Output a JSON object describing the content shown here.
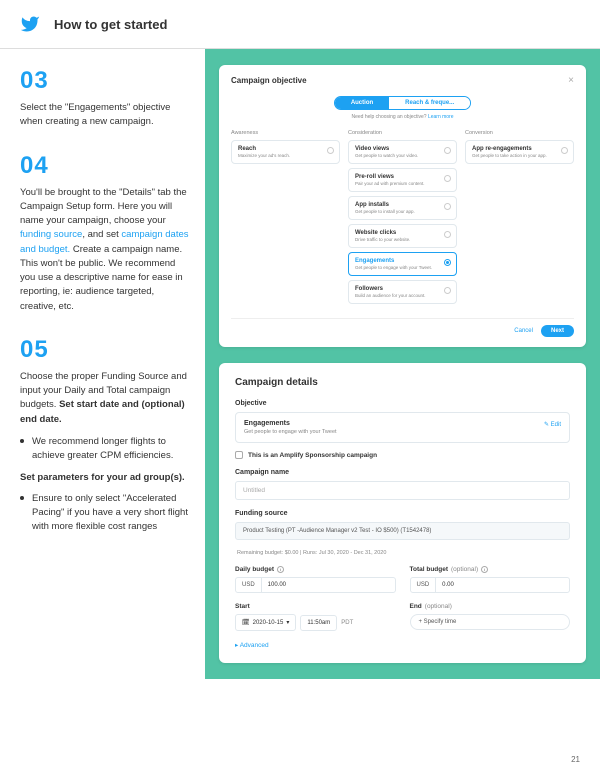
{
  "header": {
    "title": "How to get started"
  },
  "steps": {
    "s3": {
      "num": "03",
      "text": "Select the \"Engagements\" objective when creating a new campaign."
    },
    "s4": {
      "num": "04",
      "p1": "You'll be brought to the \"Details\" tab the Campaign Setup form. Here you will name your campaign, choose your ",
      "link1": "funding source",
      "p2": ", and set ",
      "link2": "campaign dates and budget.",
      "p3": " Create a campaign name. This won't be public. We recommend  you use a descriptive name for ease in reporting, ie: audience targeted, creative, etc."
    },
    "s5": {
      "num": "05",
      "p1a": "Choose the proper Funding Source and input your Daily and Total campaign budgets. ",
      "p1b": "Set start date and (optional) end date.",
      "b1": "We recommend longer flights to achieve greater CPM efficiencies.",
      "p2": "Set parameters for your ad group(s).",
      "b2": "Ensure to only select \"Accelerated Pacing\" if you have a very short flight with more flexible cost ranges"
    }
  },
  "card1": {
    "title": "Campaign objective",
    "tabAuction": "Auction",
    "tabReach": "Reach & freque...",
    "help": "Need help choosing an objective? ",
    "learnMore": "Learn more",
    "col1": {
      "head": "Awareness",
      "opts": [
        {
          "t": "Reach",
          "s": "Maximize your ad's reach."
        }
      ]
    },
    "col2": {
      "head": "Consideration",
      "opts": [
        {
          "t": "Video views",
          "s": "Get people to watch your video."
        },
        {
          "t": "Pre-roll views",
          "s": "Pair your ad with premium content."
        },
        {
          "t": "App installs",
          "s": "Get people to install your app."
        },
        {
          "t": "Website clicks",
          "s": "Drive traffic to your website."
        },
        {
          "t": "Engagements",
          "s": "Get people to engage with your Tweet."
        },
        {
          "t": "Followers",
          "s": "Build an audience for your account."
        }
      ]
    },
    "col3": {
      "head": "Conversion",
      "opts": [
        {
          "t": "App re-engagements",
          "s": "Get people to take action in your app."
        }
      ]
    },
    "cancel": "Cancel",
    "next": "Next"
  },
  "card2": {
    "title": "Campaign details",
    "objLabel": "Objective",
    "objTitle": "Engagements",
    "objSub": "Get people to engage with your Tweet",
    "edit": "Edit",
    "amplify": "This is an Amplify Sponsorship campaign",
    "nameLabel": "Campaign name",
    "namePlaceholder": "Untitled",
    "fundLabel": "Funding source",
    "fundValue": "Product Testing (PT -Audience Manager v2 Test - IO $500) (T1542478)",
    "remaining": "Remaining budget: $0.00 | Runs: Jul 30, 2020 - Dec 31, 2020",
    "dailyLabel": "Daily budget",
    "totalLabel": "Total budget",
    "optional": "(optional)",
    "usd": "USD",
    "dailyVal": "100.00",
    "totalVal": "0.00",
    "startLabel": "Start",
    "endLabel": "End",
    "startDate": "2020-10-15",
    "startTime": "11:50am",
    "tz": "PDT",
    "specify": "+ Specify time",
    "advanced": "Advanced"
  },
  "pageNum": "21"
}
